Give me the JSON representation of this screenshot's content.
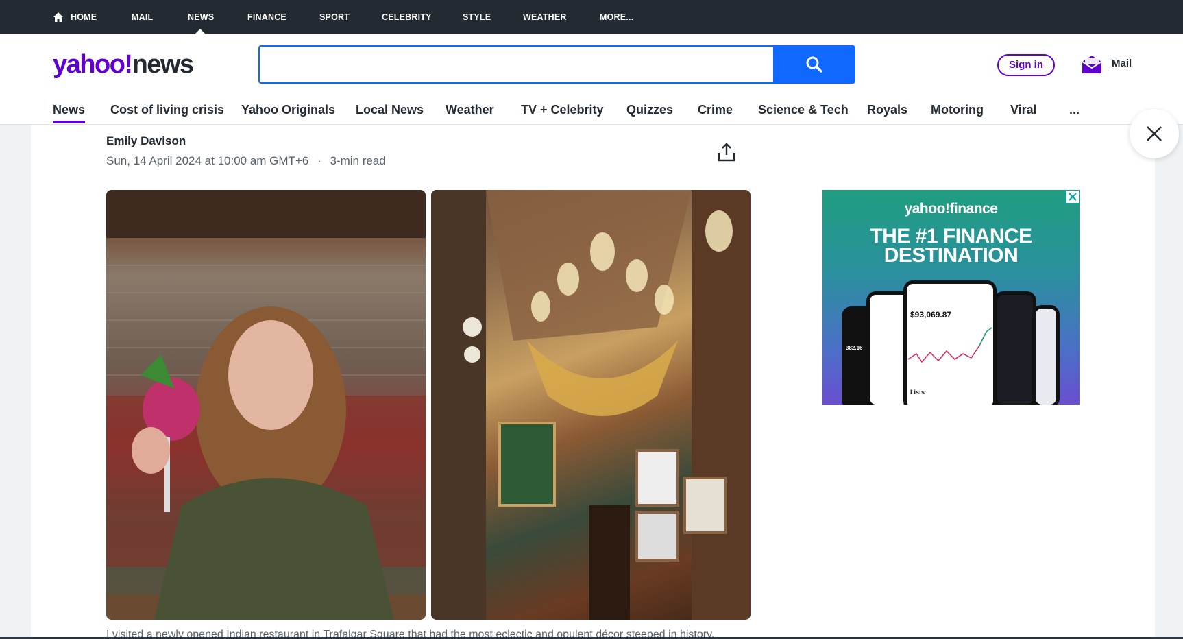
{
  "topnav": {
    "items": [
      "HOME",
      "MAIL",
      "NEWS",
      "FINANCE",
      "SPORT",
      "CELEBRITY",
      "STYLE",
      "WEATHER",
      "MORE..."
    ],
    "active": "NEWS"
  },
  "header": {
    "logo_yahoo": "yahoo!",
    "logo_news": "news",
    "search_placeholder": "",
    "signin_label": "Sign in",
    "mail_label": "Mail"
  },
  "subnav": {
    "items": [
      "News",
      "Cost of living crisis",
      "Yahoo Originals",
      "Local News",
      "Weather",
      "TV + Celebrity",
      "Quizzes",
      "Crime",
      "Science & Tech",
      "Royals",
      "Motoring",
      "Viral",
      "..."
    ],
    "active": "News"
  },
  "article": {
    "author": "Emily Davison",
    "date": "Sun, 14 April 2024 at 10:00 am GMT+6",
    "separator": "·",
    "read_time": "3-min read",
    "caption": "I visited a newly opened Indian restaurant in Trafalgar Square that had the most eclectic and opulent décor steeped in history."
  },
  "ad": {
    "brand": "yahoo!finance",
    "headline_line1": "THE #1 FINANCE",
    "headline_line2": "DESTINATION",
    "amount": "$93,069.87",
    "left_value": "382.16",
    "lists_label": "Lists"
  },
  "colors": {
    "brand_purple": "#6001d2",
    "search_blue": "#0f69ff",
    "topbar": "#232a31"
  }
}
